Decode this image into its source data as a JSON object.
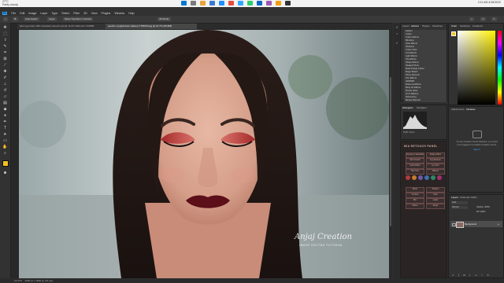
{
  "taskbar": {
    "left_lines": [
      "27°C",
      "Partly cloudy"
    ],
    "tray_time": "2:11 AM",
    "tray_date": "4/15/2022",
    "app_icon_colors": [
      "#0078d4",
      "#7a7a7a",
      "#e8a33b",
      "#3a7bd5",
      "#1e90ff",
      "#e74c3c",
      "#31a8ff",
      "#2ecc71",
      "#0a66c2",
      "#9b59b6",
      "#f39c12",
      "#333333"
    ]
  },
  "menu": {
    "logo": "Ps",
    "items": [
      "File",
      "Edit",
      "Image",
      "Layer",
      "Type",
      "Select",
      "Filter",
      "3D",
      "View",
      "Plugins",
      "Window",
      "Help"
    ]
  },
  "options": {
    "items": [
      "Auto-Select:",
      "Layer",
      "Show Transform Controls",
      "3D Mode:"
    ]
  },
  "tabs": [
    {
      "label": "karen-gemster-1b6c-unsplash-retouch.psd @ 16.2% (Retouch, RGB/8)",
      "active": false
    },
    {
      "label": "peeche-mughal-tulsi-makeup-7789163.jpg @ 16.7% (RGB/8)",
      "active": true
    }
  ],
  "status": {
    "zoom": "16.67%",
    "doc": "3000 px x 1800 px (72 ppi)"
  },
  "watermark": {
    "title": "Anjaj Creation",
    "subtitle": "IMAGE EDITING TUTORIAL"
  },
  "layers_panel_top": {
    "tabs": [
      "Layers",
      "Actions",
      "Plugins",
      "Swatches"
    ],
    "rows": [
      "Default",
      "Colour",
      "Colour Effects",
      "Blending",
      "Glow Effects",
      "Shadows",
      "Colour Filter",
      "Text Effects",
      "Light Effects",
      "Pop Effects",
      "Shape Effects",
      "Shaded Photo",
      "Mask Dodge & Burn",
      "Magic Bokeh",
      "Photo Retouch",
      "Film Effects",
      "HDR/DRI",
      "Make Up Effects",
      "Body Art Effects",
      "Moody Vibes",
      "Art & Makeup",
      "Retouching",
      "Beauty Retouch"
    ]
  },
  "color_panel": {
    "tabs": [
      "Color",
      "Swatches",
      "Gradients"
    ],
    "hue_base": "#fff200"
  },
  "histogram_panel": {
    "tabs": [
      "Histogram",
      "Navigator"
    ],
    "channel": "RGB: Colors"
  },
  "libraries_panel": {
    "tabs": [
      "Adjustments",
      "Libraries"
    ],
    "message_line1": "To use Creative Cloud Libraries, you need",
    "message_line2": "to be logged in to Adobe Creative Cloud.",
    "link": "Sign in"
  },
  "retouch_panel": {
    "title": "MIA RETOUCH PANEL",
    "buttons": [
      "Frequency Separation",
      "Dodge & Burn",
      "Skin Smooth",
      "Eye Enhance",
      "Teeth Whiten",
      "Lip Color",
      "Hair Color",
      "Makeup",
      "Brush",
      "Sharpen",
      "Contrast",
      "Glow",
      "Blur",
      "Liquify",
      "Flatten",
      "Merge"
    ],
    "dot_colors": [
      "#b33a3a",
      "#c27a2e",
      "#6e5aa8",
      "#3f6fb0",
      "#2d8a5f",
      "#a03070"
    ]
  },
  "layers_panel_bottom": {
    "tabs": [
      "Layers",
      "Channels",
      "Paths"
    ],
    "filter_label": "Kind",
    "mode": "Normal",
    "opacity_label": "Opacity: 100%",
    "fill_label": "Fill: 100%",
    "layer_name": "Background"
  },
  "colors": {
    "ps_blue": "#31a8ff",
    "foreground": "#f2c21b",
    "background": "#ffffff",
    "lip": "#5c0f18",
    "eyeshadow": "#b33030"
  }
}
